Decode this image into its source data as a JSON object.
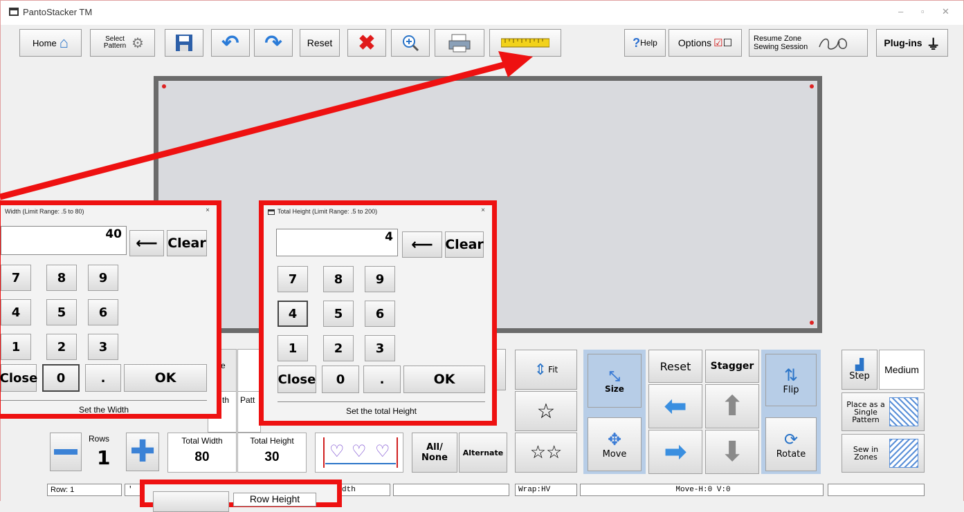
{
  "window": {
    "title": "PantoStacker TM",
    "controls": [
      "–",
      "▫",
      "✕"
    ]
  },
  "toolbar": {
    "home": "Home",
    "select_pattern": "Select Pattern",
    "reset": "Reset",
    "help": "Help",
    "options": "Options",
    "resume": "Resume Zone Sewing Session",
    "plugins": "Plug-ins"
  },
  "keypad_width": {
    "title": "Width   (Limit Range: .5 to 80)",
    "value": "40",
    "backspace": "⟵",
    "clear": "Clear",
    "keys": [
      "7",
      "8",
      "9",
      "4",
      "5",
      "6",
      "1",
      "2",
      "3"
    ],
    "close": "Close",
    "zero": "0",
    "dot": ".",
    "ok": "OK",
    "caption": "Set the Width"
  },
  "keypad_height": {
    "title": "Total Height   (Limit Range: .5 to 200)",
    "value": "4",
    "backspace": "⟵",
    "clear": "Clear",
    "keys": [
      "7",
      "8",
      "9",
      "4",
      "5",
      "6",
      "1",
      "2",
      "3"
    ],
    "close": "Close",
    "zero": "0",
    "dot": ".",
    "ok": "OK",
    "caption": "Set the total Height"
  },
  "bottom": {
    "rows_label": "Rows",
    "rows_value": "1",
    "total_width_label": "Total Width",
    "total_width_value": "80",
    "total_height_label": "Total Height",
    "total_height_value": "30",
    "partial_e": "e",
    "partial_ro": "Ro",
    "partial_th": "th",
    "partial_patt": "Patt",
    "all_none": "All/ None",
    "alternate": "Alternate",
    "fit": "Fit",
    "size": "Size",
    "move": "Move",
    "reset": "Reset",
    "stagger": "Stagger",
    "flip": "Flip",
    "rotate": "Rotate",
    "step": "Step",
    "medium": "Medium",
    "place_single": "Place as a Single Pattern",
    "sew_zones": "Sew in Zones"
  },
  "status": {
    "row": "Row: 1",
    "tick": "'",
    "width_mode": "st-width",
    "wrap": "Wrap:HV",
    "move": "Move-H:0 V:0",
    "row_height": "Row Height"
  },
  "colors": {
    "highlight": "#ee1111",
    "arrow_blue": "#3a8fe0",
    "panel_blue": "#b7cde7"
  }
}
